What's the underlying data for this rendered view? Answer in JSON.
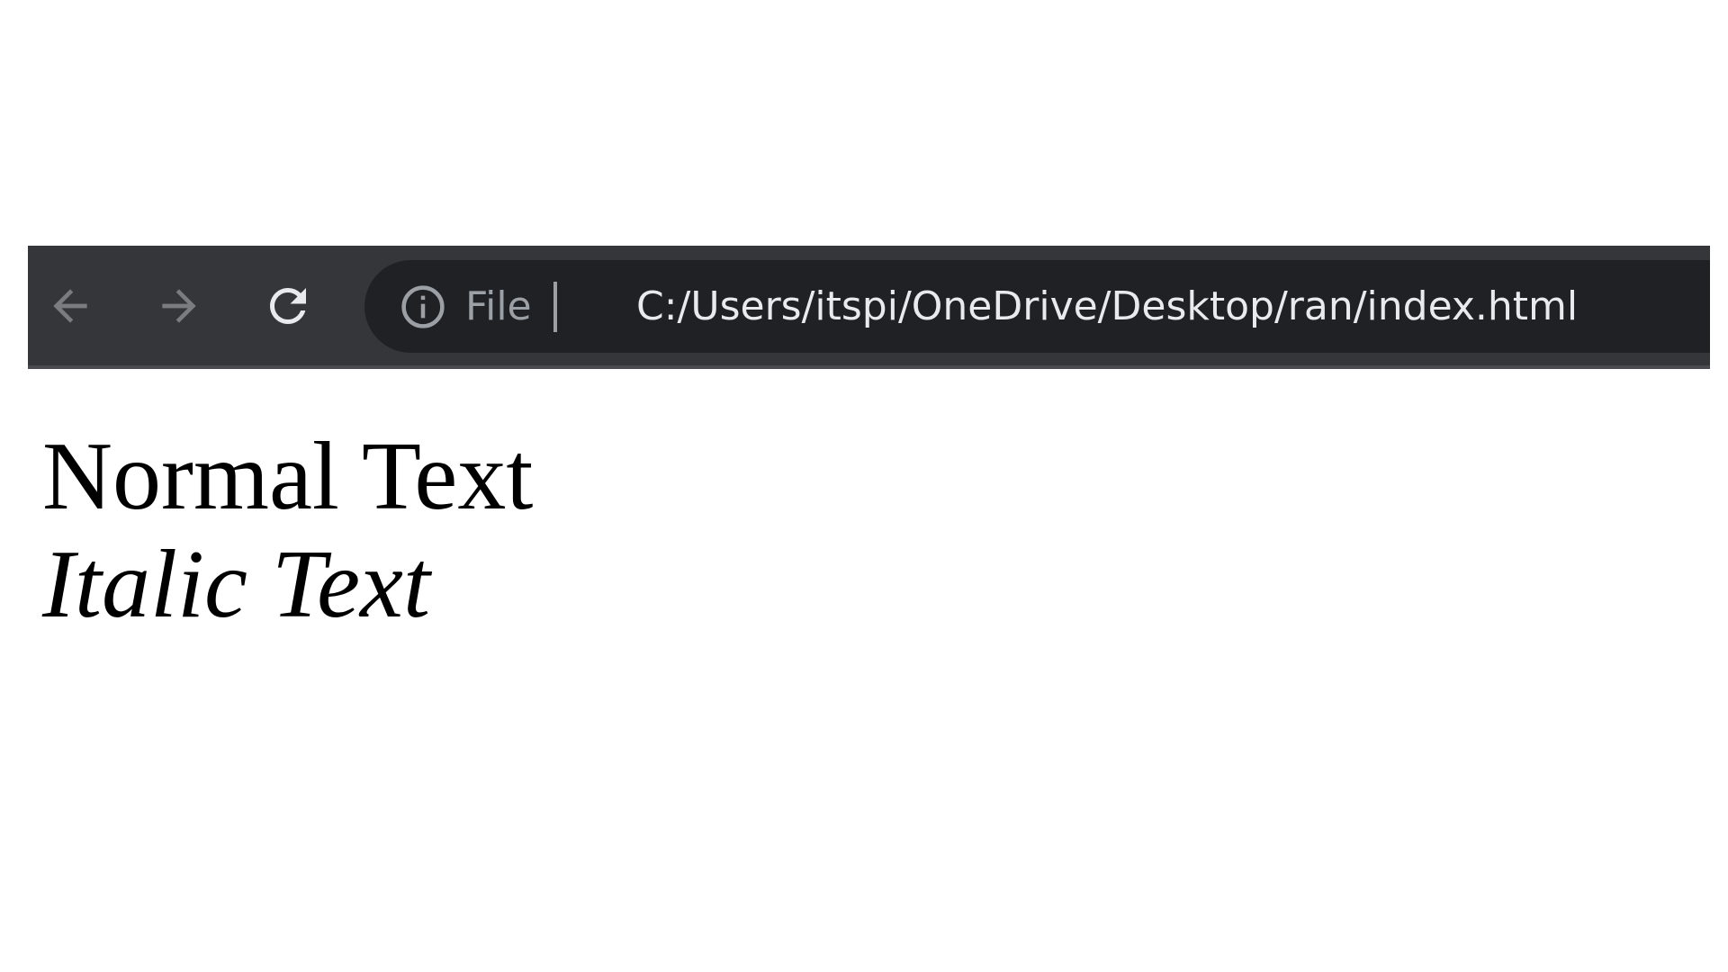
{
  "browser": {
    "site_info_label": "File",
    "url": "C:/Users/itspi/OneDrive/Desktop/ran/index.html",
    "icons": {
      "back": "arrow-left-icon",
      "forward": "arrow-right-icon",
      "reload": "reload-icon",
      "site_info": "info-icon"
    },
    "colors": {
      "toolbar": "#35363a",
      "omnibox": "#202124",
      "url_text": "#e8eaed",
      "muted_text": "#9aa0a6"
    }
  },
  "page": {
    "normal_text": "Normal Text",
    "italic_text": "Italic Text"
  }
}
